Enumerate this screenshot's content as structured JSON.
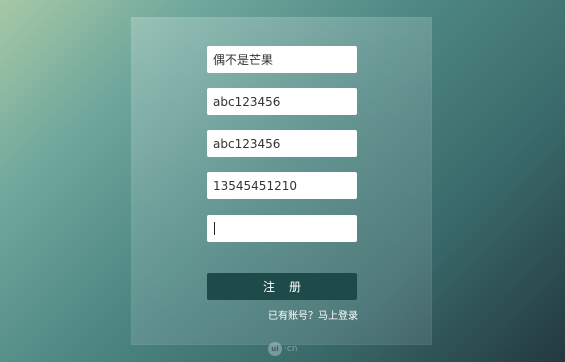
{
  "form": {
    "fields": [
      {
        "value": "偶不是芒果"
      },
      {
        "value": "abc123456"
      },
      {
        "value": "abc123456"
      },
      {
        "value": "13545451210"
      },
      {
        "value": ""
      }
    ],
    "submit_label": "注册",
    "login_link": "已有账号？马上登录"
  },
  "watermark": {
    "icon_text": "ui",
    "text": "·cn"
  },
  "colors": {
    "button_bg": "#1f4a4a",
    "field_bg": "#ffffff",
    "text_white": "#ffffff"
  }
}
